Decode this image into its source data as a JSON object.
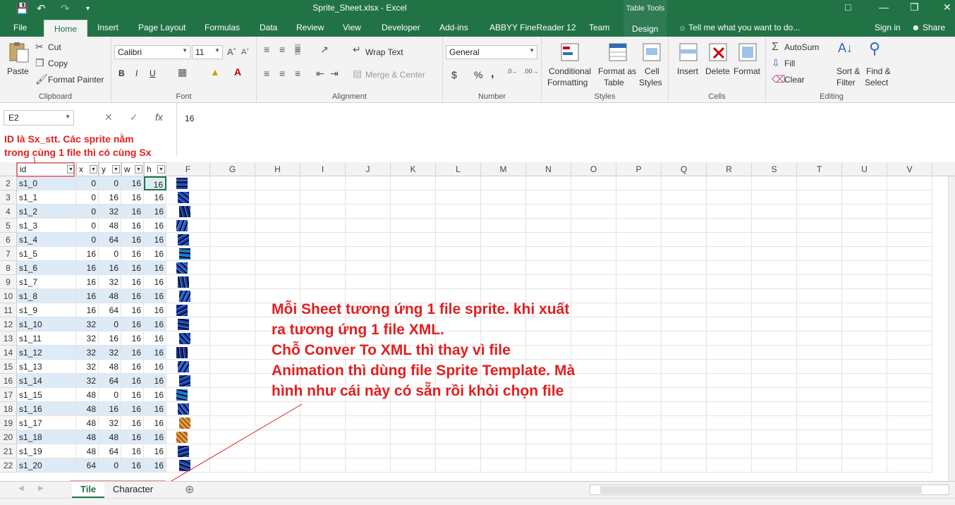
{
  "window": {
    "title": "Sprite_Sheet.xlsx - Excel",
    "table_tools": "Table Tools"
  },
  "tabs": {
    "file": "File",
    "home": "Home",
    "insert": "Insert",
    "page_layout": "Page Layout",
    "formulas": "Formulas",
    "data": "Data",
    "review": "Review",
    "view": "View",
    "developer": "Developer",
    "addins": "Add-ins",
    "abbyy": "ABBYY FineReader 12",
    "team": "Team",
    "design": "Design",
    "tell_me": "Tell me what you want to do...",
    "sign_in": "Sign in",
    "share": "Share"
  },
  "ribbon": {
    "clipboard": {
      "paste": "Paste",
      "cut": "Cut",
      "copy": "Copy",
      "format_painter": "Format Painter",
      "label": "Clipboard"
    },
    "font": {
      "name": "Calibri",
      "size": "11",
      "bold": "B",
      "italic": "I",
      "underline": "U",
      "label": "Font"
    },
    "alignment": {
      "wrap_text": "Wrap Text",
      "merge_center": "Merge & Center",
      "label": "Alignment"
    },
    "number": {
      "format": "General",
      "currency": "$",
      "percent": "%",
      "comma": ",",
      "label": "Number"
    },
    "styles": {
      "conditional1": "Conditional",
      "conditional2": "Formatting",
      "format_as1": "Format as",
      "format_as2": "Table",
      "cell1": "Cell",
      "cell2": "Styles",
      "label": "Styles"
    },
    "cells": {
      "insert": "Insert",
      "delete": "Delete",
      "format": "Format",
      "label": "Cells"
    },
    "editing": {
      "autosum": "AutoSum",
      "fill": "Fill",
      "clear": "Clear",
      "sort1": "Sort &",
      "sort2": "Filter",
      "find1": "Find &",
      "find2": "Select",
      "label": "Editing"
    }
  },
  "formula_bar": {
    "name_box": "E2",
    "fx": "fx",
    "value": "16"
  },
  "annotations": {
    "note1_line1": "ID là Sx_stt. Các sprite nằm",
    "note1_line2": "trong cùng 1 file thì có cùng Sx",
    "note2_line1": "Mỗi Sheet tương ứng 1 file sprite. khi xuất",
    "note2_line2": "ra tương ứng 1 file XML.",
    "note2_line3": "Chỗ Conver To XML thì thay vì file",
    "note2_line4": "Animation thì dùng file Sprite Template. Mà",
    "note2_line5": "hình như cái này có sẵn rồi khỏi chọn file"
  },
  "columns": [
    "F",
    "G",
    "H",
    "I",
    "J",
    "K",
    "L",
    "M",
    "N",
    "O",
    "P",
    "Q",
    "R",
    "S",
    "T",
    "U",
    "V"
  ],
  "table": {
    "headers": {
      "id": "id",
      "x": "x",
      "y": "y",
      "w": "w",
      "h": "h"
    },
    "rows": [
      {
        "row": "2",
        "id": "s1_0",
        "x": "0",
        "y": "0",
        "w": "16",
        "h": "16"
      },
      {
        "row": "3",
        "id": "s1_1",
        "x": "0",
        "y": "16",
        "w": "16",
        "h": "16"
      },
      {
        "row": "4",
        "id": "s1_2",
        "x": "0",
        "y": "32",
        "w": "16",
        "h": "16"
      },
      {
        "row": "5",
        "id": "s1_3",
        "x": "0",
        "y": "48",
        "w": "16",
        "h": "16"
      },
      {
        "row": "6",
        "id": "s1_4",
        "x": "0",
        "y": "64",
        "w": "16",
        "h": "16"
      },
      {
        "row": "7",
        "id": "s1_5",
        "x": "16",
        "y": "0",
        "w": "16",
        "h": "16"
      },
      {
        "row": "8",
        "id": "s1_6",
        "x": "16",
        "y": "16",
        "w": "16",
        "h": "16"
      },
      {
        "row": "9",
        "id": "s1_7",
        "x": "16",
        "y": "32",
        "w": "16",
        "h": "16"
      },
      {
        "row": "10",
        "id": "s1_8",
        "x": "16",
        "y": "48",
        "w": "16",
        "h": "16"
      },
      {
        "row": "11",
        "id": "s1_9",
        "x": "16",
        "y": "64",
        "w": "16",
        "h": "16"
      },
      {
        "row": "12",
        "id": "s1_10",
        "x": "32",
        "y": "0",
        "w": "16",
        "h": "16"
      },
      {
        "row": "13",
        "id": "s1_11",
        "x": "32",
        "y": "16",
        "w": "16",
        "h": "16"
      },
      {
        "row": "14",
        "id": "s1_12",
        "x": "32",
        "y": "32",
        "w": "16",
        "h": "16"
      },
      {
        "row": "15",
        "id": "s1_13",
        "x": "32",
        "y": "48",
        "w": "16",
        "h": "16"
      },
      {
        "row": "16",
        "id": "s1_14",
        "x": "32",
        "y": "64",
        "w": "16",
        "h": "16"
      },
      {
        "row": "17",
        "id": "s1_15",
        "x": "48",
        "y": "0",
        "w": "16",
        "h": "16"
      },
      {
        "row": "18",
        "id": "s1_16",
        "x": "48",
        "y": "16",
        "w": "16",
        "h": "16"
      },
      {
        "row": "19",
        "id": "s1_17",
        "x": "48",
        "y": "32",
        "w": "16",
        "h": "16"
      },
      {
        "row": "20",
        "id": "s1_18",
        "x": "48",
        "y": "48",
        "w": "16",
        "h": "16"
      },
      {
        "row": "21",
        "id": "s1_19",
        "x": "48",
        "y": "64",
        "w": "16",
        "h": "16"
      },
      {
        "row": "22",
        "id": "s1_20",
        "x": "64",
        "y": "0",
        "w": "16",
        "h": "16"
      }
    ]
  },
  "sheets": {
    "tile": "Tile",
    "character": "Character"
  },
  "colors": {
    "excel_green": "#217346",
    "annotation_red": "#e02020",
    "table_band": "#ddebf7"
  }
}
